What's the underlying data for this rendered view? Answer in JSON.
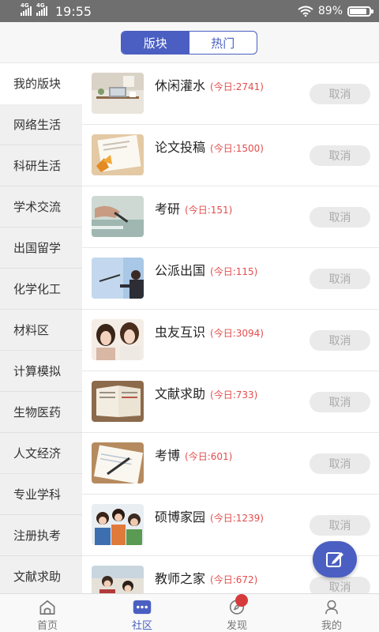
{
  "status_bar": {
    "network_1": "4G",
    "network_2": "4G",
    "time": "19:55",
    "battery_text": "89%",
    "battery_level": 0.89
  },
  "segment": {
    "tabs": [
      "版块",
      "热门"
    ],
    "active": "版块"
  },
  "sidebar": {
    "items": [
      "我的版块",
      "网络生活",
      "科研生活",
      "学术交流",
      "出国留学",
      "化学化工",
      "材料区",
      "计算模拟",
      "生物医药",
      "人文经济",
      "专业学科",
      "注册执考",
      "文献求助"
    ],
    "active": "我的版块"
  },
  "forums": [
    {
      "name": "休闲灌水",
      "today": "(今日:2741)",
      "button": "取消",
      "thumb": "office-desk"
    },
    {
      "name": "论文投稿",
      "today": "(今日:1500)",
      "button": "取消",
      "thumb": "papers-leaf"
    },
    {
      "name": "考研",
      "today": "(今日:151)",
      "button": "取消",
      "thumb": "hand-writing"
    },
    {
      "name": "公派出国",
      "today": "(今日:115)",
      "button": "取消",
      "thumb": "presentation"
    },
    {
      "name": "虫友互识",
      "today": "(今日:3094)",
      "button": "取消",
      "thumb": "two-women"
    },
    {
      "name": "文献求助",
      "today": "(今日:733)",
      "button": "取消",
      "thumb": "open-book"
    },
    {
      "name": "考博",
      "today": "(今日:601)",
      "button": "取消",
      "thumb": "pen-notebook"
    },
    {
      "name": "硕博家园",
      "today": "(今日:1239)",
      "button": "取消",
      "thumb": "students-group"
    },
    {
      "name": "教师之家",
      "today": "(今日:672)",
      "button": "取消",
      "thumb": "teacher-class"
    }
  ],
  "bottom_nav": {
    "items": [
      {
        "label": "首页",
        "icon": "home-icon"
      },
      {
        "label": "社区",
        "icon": "community-icon"
      },
      {
        "label": "发现",
        "icon": "compass-icon"
      },
      {
        "label": "我的",
        "icon": "user-icon"
      }
    ],
    "active": "社区"
  },
  "colors": {
    "accent": "#4a5fc1",
    "today_red": "#e44c4c",
    "badge_red": "#d63b3b"
  }
}
